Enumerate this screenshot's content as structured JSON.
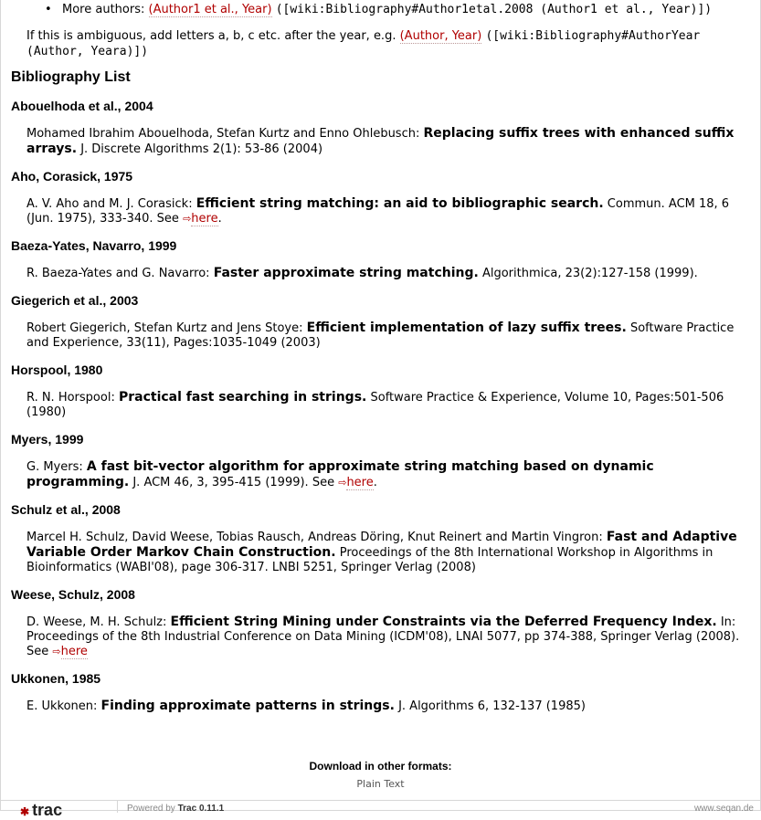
{
  "intro": {
    "bullet_label": "More authors:",
    "bullet_link": "(Author1 et al., Year)",
    "bullet_code": "([wiki:Bibliography#Author1etal.2008 (Author1 et al., Year)])",
    "note_text": "If this is ambiguous, add letters a, b, c etc. after the year, e.g.",
    "note_link": "(Author, Year)",
    "note_code": "([wiki:Bibliography#AuthorYear (Author, Yeara)])"
  },
  "bibliography_title": "Bibliography List",
  "entries": [
    {
      "key": "Abouelhoda et al., 2004",
      "authors": "Mohamed Ibrahim Abouelhoda, Stefan Kurtz and Enno Ohlebusch:",
      "title": "Replacing suffix trees with enhanced suffix arrays.",
      "venue": "J. Discrete Algorithms 2(1): 53-86 (2004)",
      "see": "",
      "see_link": ""
    },
    {
      "key": "Aho, Corasick, 1975",
      "authors": "A. V. Aho and M. J. Corasick:",
      "title": "Efficient string matching: an aid to bibliographic search.",
      "venue": "Commun. ACM 18, 6 (Jun. 1975), 333-340.",
      "see": "See",
      "see_link": "here",
      "see_tail": "."
    },
    {
      "key": "Baeza-Yates, Navarro, 1999",
      "authors": "R. Baeza-Yates and G. Navarro:",
      "title": "Faster approximate string matching.",
      "venue": "Algorithmica, 23(2):127-158 (1999).",
      "see": "",
      "see_link": ""
    },
    {
      "key": "Giegerich et al., 2003",
      "authors": "Robert Giegerich, Stefan Kurtz and Jens Stoye:",
      "title": "Efficient implementation of lazy suffix trees.",
      "venue": "Software Practice and Experience, 33(11), Pages:1035-1049 (2003)",
      "see": "",
      "see_link": ""
    },
    {
      "key": "Horspool, 1980",
      "authors": "R. N. Horspool:",
      "title": "Practical fast searching in strings.",
      "venue": "Software Practice & Experience, Volume 10, Pages:501-506 (1980)",
      "see": "",
      "see_link": ""
    },
    {
      "key": "Myers, 1999",
      "authors": "G. Myers:",
      "title": "A fast bit-vector algorithm for approximate string matching based on dynamic programming.",
      "venue": "J. ACM 46, 3, 395-415 (1999).",
      "see": "See",
      "see_link": "here",
      "see_tail": "."
    },
    {
      "key": "Schulz et al., 2008",
      "authors": "Marcel H. Schulz, David Weese, Tobias Rausch, Andreas Döring, Knut Reinert and Martin Vingron:",
      "title": "Fast and Adaptive Variable Order Markov Chain Construction.",
      "venue": "Proceedings of the 8th International Workshop in Algorithms in Bioinformatics (WABI'08), page 306-317. LNBI 5251, Springer Verlag (2008)",
      "see": "",
      "see_link": ""
    },
    {
      "key": "Weese, Schulz, 2008",
      "authors": "D. Weese, M. H. Schulz:",
      "title": "Efficient String Mining under Constraints via the Deferred Frequency Index.",
      "venue": "In: Proceedings of the 8th Industrial Conference on Data Mining (ICDM'08), LNAI 5077, pp 374-388, Springer Verlag (2008).",
      "see": "See",
      "see_link": "here",
      "see_tail": ""
    },
    {
      "key": "Ukkonen, 1985",
      "authors": "E. Ukkonen:",
      "title": "Finding approximate patterns in strings.",
      "venue": "J. Algorithms 6, 132-137 (1985)",
      "see": "",
      "see_link": ""
    }
  ],
  "downloads": {
    "title": "Download in other formats:",
    "plain_text": "Plain Text"
  },
  "footer": {
    "logo": "trac",
    "powered_prefix": "Powered by",
    "powered_name": "Trac 0.11.1",
    "site": "www.seqan.de"
  },
  "colors": {
    "link": "#b00000",
    "border": "#d7d7d7"
  }
}
